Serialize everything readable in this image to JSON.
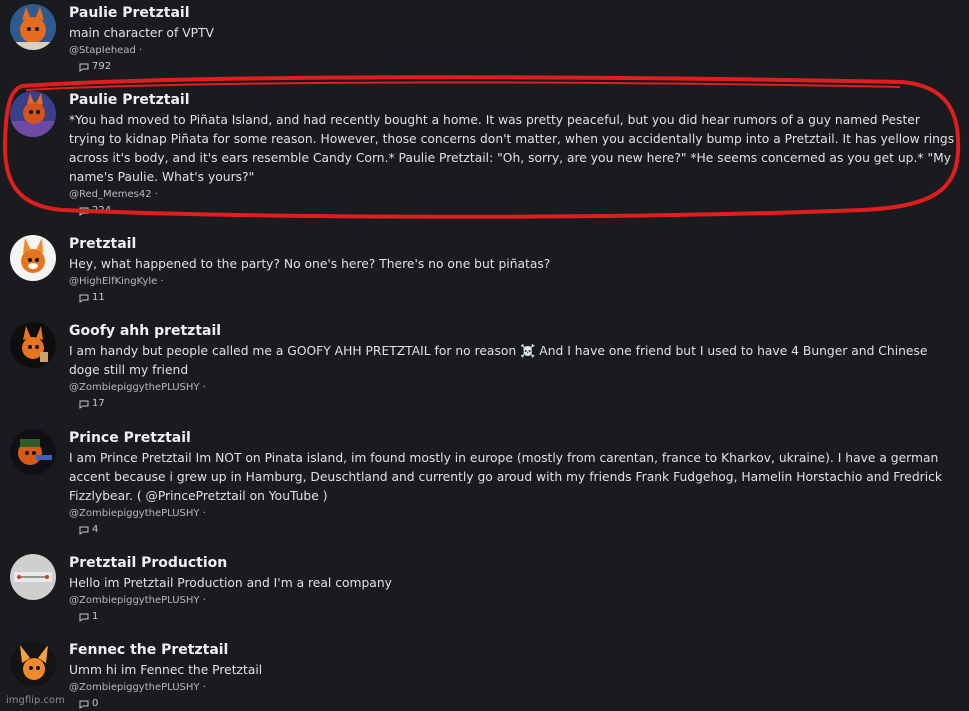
{
  "results": [
    {
      "name": "Paulie Pretztail",
      "description": "main character of VPTV",
      "handle": "@StapIehead ·",
      "count": "792",
      "avatar_icon": "fox-character-avatar-icon"
    },
    {
      "name": "Paulie Pretztail",
      "description": "*You had moved to Piñata Island, and had recently bought a home. It was pretty peaceful, but you did hear rumors of a guy named Pester trying to kidnap Piñata for some reason. However, those concerns don't matter, when you accidentally bump into a Pretztail. It has yellow rings across it's body, and it's ears resemble Candy Corn.* Paulie Pretztail: \"Oh, sorry, are you new here?\" *He seems concerned as you get up.* \"My name's Paulie. What's yours?\"",
      "handle": "@Red_Memes42 ·",
      "count": "224",
      "avatar_icon": "fox-character-avatar-icon"
    },
    {
      "name": "Pretztail",
      "description": "Hey, what happened to the party? No one's here? There's no one but piñatas?",
      "handle": "@HighElfKingKyle ·",
      "count": "11",
      "avatar_icon": "fox-character-avatar-icon"
    },
    {
      "name": "Goofy ahh pretztail",
      "description": "I am handy but people called me a GOOFY AHH PRETZTAIL for no reason ☠️ And I have one friend but I used to have 4 Bunger and Chinese doge still my friend",
      "handle": "@ZombiepiggythePLUSHY ·",
      "count": "17",
      "avatar_icon": "fox-character-avatar-icon"
    },
    {
      "name": "Prince Pretztail",
      "description": "I am Prince Pretztail Im NOT on Pinata island, im found mostly in europe (mostly from carentan, france to Kharkov, ukraine). I have a german accent because i grew up in Hamburg, Deuschtland and currently go aroud with my friends Frank Fudgehog, Hamelin Horstachio and Fredrick Fizzlybear. ( @PrincePretztail on YouTube )",
      "handle": "@ZombiepiggythePLUSHY ·",
      "count": "4",
      "avatar_icon": "fox-character-avatar-icon"
    },
    {
      "name": "Pretztail Production",
      "description": "Hello im Pretztail Production and I'm a real company",
      "handle": "@ZombiepiggythePLUSHY ·",
      "count": "1",
      "avatar_icon": "logo-avatar-icon"
    },
    {
      "name": "Fennec the Pretztail",
      "description": "Umm hi im Fennec the Pretztail",
      "handle": "@ZombiepiggythePLUSHY ·",
      "count": "0",
      "avatar_icon": "fox-character-avatar-icon"
    }
  ],
  "watermark": "imgflip.com",
  "colors": {
    "background": "#1a1b1f",
    "highlight": "#e01e1e",
    "text": "#e7e7ea",
    "muted": "#b8b8bd"
  }
}
